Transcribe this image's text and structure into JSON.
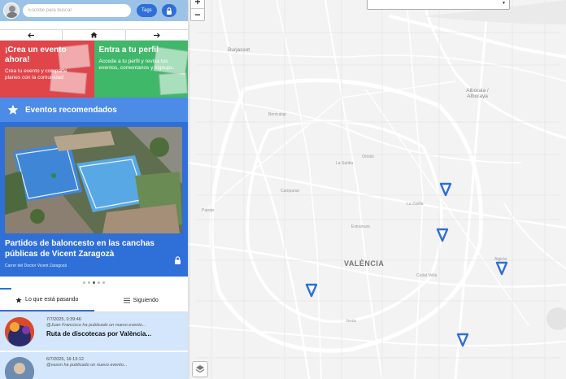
{
  "header": {
    "search_placeholder": "Escribe para buscar",
    "tags_label": "Tags"
  },
  "nav": {
    "back_icon": "arrow-left-icon",
    "home_icon": "home-icon",
    "forward_icon": "arrow-right-icon"
  },
  "promo": {
    "create": {
      "title": "¡Crea un evento ahora!",
      "text": "Crea tu evento y comparte planes con la comunidad"
    },
    "login": {
      "title": "Entra a tu perfil",
      "text": "Accede a tu perfil y revisa tus eventos, comentarios y signups."
    }
  },
  "recommended": {
    "title": "Eventos recomendados",
    "event": {
      "title": "Partidos de baloncesto en las canchas públicas de Vicent Zaragozà",
      "address": "Carrer del Doctor Vicent Zaragozà"
    },
    "slides": 5,
    "active_slide": 3
  },
  "tabs": [
    {
      "label": "Lo que está pasando",
      "icon": "star-icon",
      "active": true
    },
    {
      "label": "Siguiendo",
      "icon": "list-icon",
      "active": false
    }
  ],
  "feed": [
    {
      "time": "7/7/2025, 0:39:46",
      "message": "@Juan Francisco ha publicado un nuevo evento...",
      "title": "Ruta de discotecas por València..."
    },
    {
      "time": "6/7/2025, 16:13:12",
      "message": "@vassn ha publicado un nuevo evento...",
      "title": ""
    }
  ],
  "map": {
    "city_label": "VALÈNCIA",
    "labels": {
      "burjassot": "Burjassot",
      "alboraya": "Alboraia / Alboraya",
      "benicalap": "Benicalap",
      "orriols": "Orriols",
      "la_zaidia": "La Zaidia",
      "campanar": "Campanar",
      "extramurs": "Extramurs",
      "patraix": "Patraix",
      "la_saidia": "La Saïdia",
      "algiros": "Algirós",
      "ciutat_vella": "Ciutat Vella",
      "jesus": "Jesús"
    },
    "markers": 5,
    "colors": {
      "marker": "#2f6fd8"
    }
  },
  "colors": {
    "topbar": "#9cc3e6",
    "primary": "#2f6fd8",
    "promo_red": "#e0454a",
    "promo_green": "#40b86a",
    "feed_bg": "#d4e6fb"
  }
}
